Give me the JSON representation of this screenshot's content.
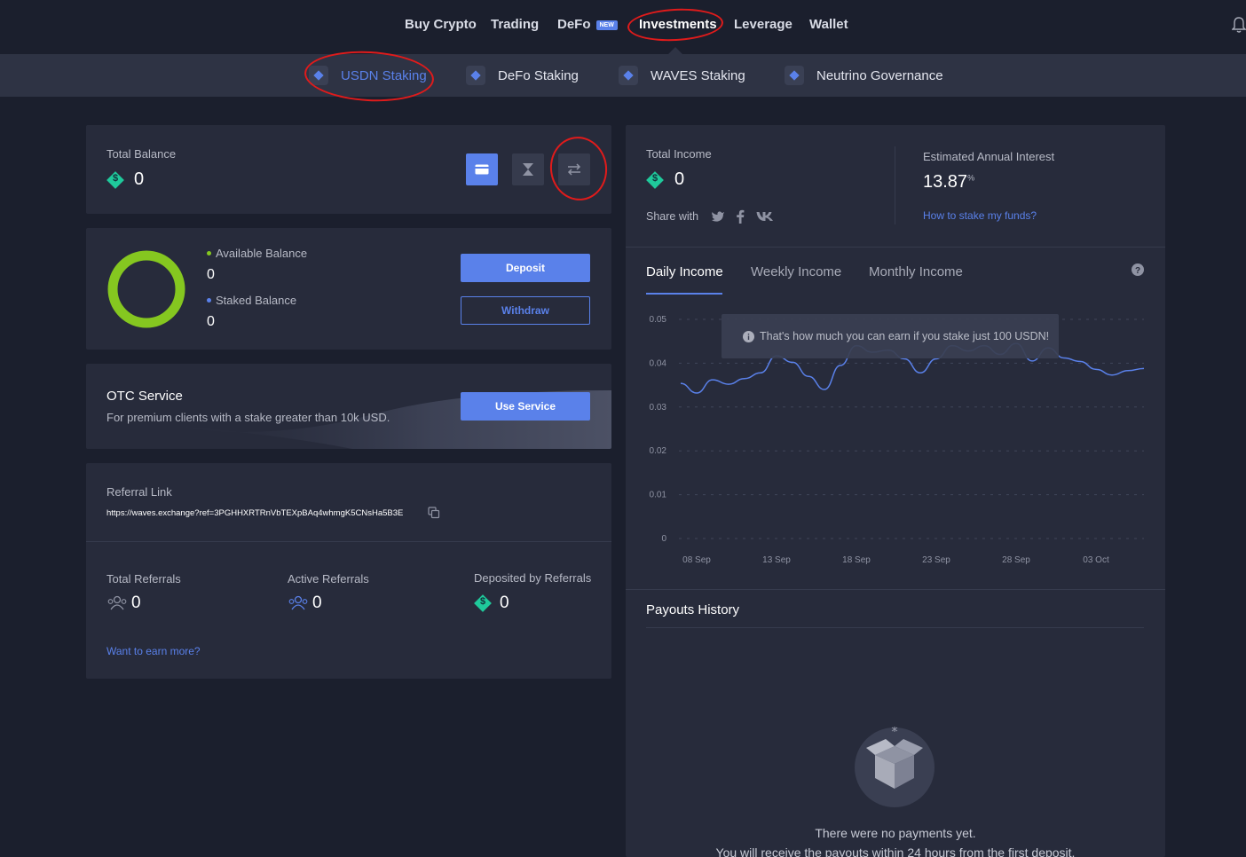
{
  "topnav": {
    "items": [
      "Buy Crypto",
      "Trading",
      "DeFo",
      "Investments",
      "Leverage",
      "Wallet"
    ],
    "new_badge": "NEW",
    "active": "Investments"
  },
  "subnav": {
    "items": [
      "USDN Staking",
      "DeFo Staking",
      "WAVES Staking",
      "Neutrino Governance"
    ],
    "active": "USDN Staking"
  },
  "balance": {
    "total_label": "Total Balance",
    "total_value": "0",
    "available_label": "Available Balance",
    "available_value": "0",
    "staked_label": "Staked Balance",
    "staked_value": "0",
    "deposit_label": "Deposit",
    "withdraw_label": "Withdraw"
  },
  "otc": {
    "title": "OTC Service",
    "subtitle": "For premium clients with a stake greater than 10k USD.",
    "button_label": "Use Service"
  },
  "referral": {
    "link_label": "Referral Link",
    "link_value": "https://waves.exchange?ref=3PGHHXRTRnVbTEXpBAq4whmgK5CNsHa5B3E",
    "total_label": "Total Referrals",
    "total_value": "0",
    "active_label": "Active Referrals",
    "active_value": "0",
    "deposited_label": "Deposited by Referrals",
    "deposited_value": "0",
    "earn_more_label": "Want to earn more?"
  },
  "income": {
    "total_label": "Total Income",
    "total_value": "0",
    "share_label": "Share with",
    "interest_label": "Estimated Annual Interest",
    "interest_value": "13.87",
    "interest_unit": "%",
    "how_to_label": "How to stake my funds?",
    "tabs": [
      "Daily Income",
      "Weekly Income",
      "Monthly Income"
    ],
    "active_tab": "Daily Income",
    "tooltip": "That's how much you can earn if you stake just 100 USDN!"
  },
  "chart_data": {
    "type": "line",
    "title": "",
    "xlabel": "",
    "ylabel": "",
    "ylim": [
      0,
      0.05
    ],
    "yticks": [
      0,
      0.01,
      0.02,
      0.03,
      0.04,
      0.05
    ],
    "xtick_labels": [
      "08 Sep",
      "13 Sep",
      "18 Sep",
      "23 Sep",
      "28 Sep",
      "03 Oct"
    ],
    "x": [
      "07 Sep",
      "08 Sep",
      "09 Sep",
      "10 Sep",
      "11 Sep",
      "12 Sep",
      "13 Sep",
      "14 Sep",
      "15 Sep",
      "16 Sep",
      "17 Sep",
      "18 Sep",
      "19 Sep",
      "20 Sep",
      "21 Sep",
      "22 Sep",
      "23 Sep",
      "24 Sep",
      "25 Sep",
      "26 Sep",
      "27 Sep",
      "28 Sep",
      "29 Sep",
      "30 Sep",
      "01 Oct",
      "02 Oct",
      "03 Oct",
      "04 Oct",
      "05 Oct",
      "06 Oct"
    ],
    "series": [
      {
        "values": [
          0.0354,
          0.0332,
          0.0362,
          0.0352,
          0.0365,
          0.0378,
          0.0417,
          0.0402,
          0.037,
          0.034,
          0.0395,
          0.044,
          0.0425,
          0.043,
          0.041,
          0.0378,
          0.041,
          0.044,
          0.0428,
          0.044,
          0.042,
          0.0445,
          0.0405,
          0.0435,
          0.0412,
          0.0404,
          0.0386,
          0.0373,
          0.0383,
          0.0388
        ],
        "color": "#5a81ea"
      }
    ],
    "grid": true
  },
  "payouts": {
    "title": "Payouts History",
    "empty_line1": "There were no payments yet.",
    "empty_line2": "You will receive the payouts within 24 hours from the first deposit."
  },
  "colors": {
    "background": "#1b1f2d",
    "card": "#272b3b",
    "accent": "#5a81ea",
    "ring": "#85c720",
    "usdn": "#1fc99b",
    "annotation": "#e01b1b"
  }
}
